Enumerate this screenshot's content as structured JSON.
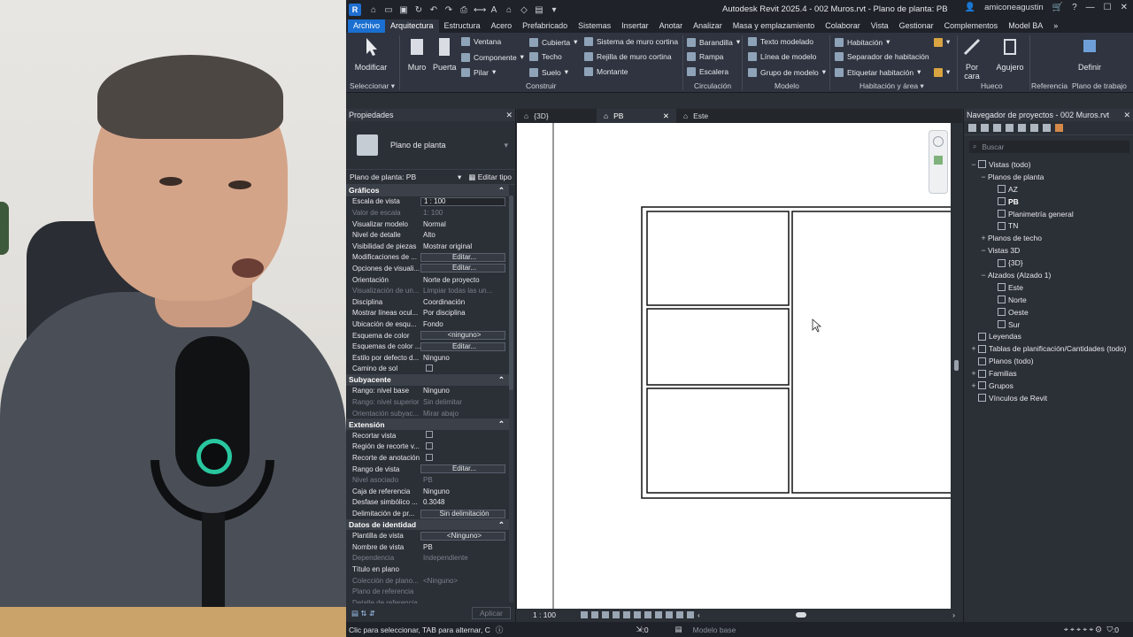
{
  "titlebar": {
    "app_icon_letter": "R",
    "title": "Autodesk Revit 2025.4 - 002 Muros.rvt - Plano de planta: PB",
    "user": "amiconeagustin"
  },
  "ribbon_tabs": [
    "Arquitectura",
    "Estructura",
    "Acero",
    "Prefabricado",
    "Sistemas",
    "Insertar",
    "Anotar",
    "Analizar",
    "Masa y emplazamiento",
    "Colaborar",
    "Vista",
    "Gestionar",
    "Complementos",
    "Model BA"
  ],
  "ribbon_file_tab": "Archivo",
  "ribbon": {
    "modificar": "Modificar",
    "seleccionar": "Seleccionar",
    "muro": "Muro",
    "puerta": "Puerta",
    "ventana": "Ventana",
    "componente": "Componente",
    "pilar": "Pilar",
    "cubierta": "Cubierta",
    "techo": "Techo",
    "suelo": "Suelo",
    "sistema_muro_cortina": "Sistema de muro cortina",
    "rejilla_muro_cortina": "Rejilla de muro cortina",
    "montante": "Montante",
    "construir": "Construir",
    "barandilla": "Barandilla",
    "rampa": "Rampa",
    "escalera": "Escalera",
    "circulacion": "Circulación",
    "texto_modelado": "Texto modelado",
    "linea_modelo": "Línea de modelo",
    "grupo_modelo": "Grupo de modelo",
    "modelo": "Modelo",
    "habitacion": "Habitación",
    "separador_habitacion": "Separador de habitación",
    "etiquetar_habitacion": "Etiquetar habitación",
    "habitacion_area": "Habitación y área",
    "por_cara": "Por cara",
    "agujero": "Agujero",
    "hueco": "Hueco",
    "referencia": "Referencia",
    "definir": "Definir",
    "plano_trabajo": "Plano de trabajo"
  },
  "properties": {
    "title": "Propiedades",
    "type_name": "Plano de planta",
    "instance_selector": "Plano de planta: PB",
    "edit_type": "Editar tipo",
    "sections": [
      {
        "name": "Gráficos",
        "rows": [
          {
            "n": "Escala de vista",
            "v": "1 : 100",
            "kind": "box"
          },
          {
            "n": "Valor de escala",
            "v": "100",
            "pre": "1:",
            "dim": true
          },
          {
            "n": "Visualizar modelo",
            "v": "Normal"
          },
          {
            "n": "Nivel de detalle",
            "v": "Alto"
          },
          {
            "n": "Visibilidad de piezas",
            "v": "Mostrar original"
          },
          {
            "n": "Modificaciones de ...",
            "v": "Editar...",
            "kind": "btn"
          },
          {
            "n": "Opciones de visuali...",
            "v": "Editar...",
            "kind": "btn"
          },
          {
            "n": "Orientación",
            "v": "Norte de proyecto"
          },
          {
            "n": "Visualización de un...",
            "v": "Limpiar todas las un...",
            "dim": true
          },
          {
            "n": "Disciplina",
            "v": "Coordinación"
          },
          {
            "n": "Mostrar líneas ocul...",
            "v": "Por disciplina"
          },
          {
            "n": "Ubicación de esqu...",
            "v": "Fondo"
          },
          {
            "n": "Esquema de color",
            "v": "<ninguno>",
            "kind": "btn"
          },
          {
            "n": "Esquemas de color ...",
            "v": "Editar...",
            "kind": "btn"
          },
          {
            "n": "Estilo por defecto d...",
            "v": "Ninguno"
          },
          {
            "n": "Camino de sol",
            "v": "",
            "kind": "chk"
          }
        ]
      },
      {
        "name": "Subyacente",
        "rows": [
          {
            "n": "Rango: nivel base",
            "v": "Ninguno"
          },
          {
            "n": "Rango: nivel superior",
            "v": "Sin delimitar",
            "dim": true
          },
          {
            "n": "Orientación subyac...",
            "v": "Mirar abajo",
            "dim": true
          }
        ]
      },
      {
        "name": "Extensión",
        "rows": [
          {
            "n": "Recortar vista",
            "v": "",
            "kind": "chk"
          },
          {
            "n": "Región de recorte v...",
            "v": "",
            "kind": "chk"
          },
          {
            "n": "Recorte de anotación",
            "v": "",
            "kind": "chk"
          },
          {
            "n": "Rango de vista",
            "v": "Editar...",
            "kind": "btn"
          },
          {
            "n": "Nivel asociado",
            "v": "PB",
            "dim": true
          },
          {
            "n": "Caja de referencia",
            "v": "Ninguno"
          },
          {
            "n": "Desfase simbólico ...",
            "v": "0.3048"
          },
          {
            "n": "Delimitación de pr...",
            "v": "Sin delimitación",
            "kind": "btn"
          }
        ]
      },
      {
        "name": "Datos de identidad",
        "rows": [
          {
            "n": "Plantilla de vista",
            "v": "<Ninguno>",
            "kind": "btn"
          },
          {
            "n": "Nombre de vista",
            "v": "PB"
          },
          {
            "n": "Dependencia",
            "v": "Independiente",
            "dim": true
          },
          {
            "n": "Título en plano",
            "v": ""
          },
          {
            "n": "Colección de plano...",
            "v": "<Ninguno>",
            "dim": true
          },
          {
            "n": "Plano de referencia",
            "v": "",
            "dim": true
          },
          {
            "n": "Detalle de referencia",
            "v": "",
            "dim": true
          }
        ]
      }
    ],
    "apply": "Aplicar"
  },
  "view_tabs": [
    {
      "label": "{3D}",
      "active": false,
      "closable": false
    },
    {
      "label": "PB",
      "active": true,
      "closable": true
    },
    {
      "label": "Este",
      "active": false,
      "closable": false
    }
  ],
  "view_status": {
    "scale": "1 : 100"
  },
  "browser": {
    "title": "Navegador de proyectos - 002 Muros.rvt",
    "search_placeholder": "Buscar",
    "tree": [
      {
        "label": "Vistas (todo)",
        "indent": 0,
        "toggle": "−",
        "icon": true
      },
      {
        "label": "Planos de planta",
        "indent": 1,
        "toggle": "−",
        "icon": false
      },
      {
        "label": "AZ",
        "indent": 2,
        "toggle": "",
        "icon": true
      },
      {
        "label": "PB",
        "indent": 2,
        "toggle": "",
        "icon": true,
        "bold": true
      },
      {
        "label": "Planimetría general",
        "indent": 2,
        "toggle": "",
        "icon": true
      },
      {
        "label": "TN",
        "indent": 2,
        "toggle": "",
        "icon": true
      },
      {
        "label": "Planos de techo",
        "indent": 1,
        "toggle": "+",
        "icon": false
      },
      {
        "label": "Vistas 3D",
        "indent": 1,
        "toggle": "−",
        "icon": false
      },
      {
        "label": "{3D}",
        "indent": 2,
        "toggle": "",
        "icon": true
      },
      {
        "label": "Alzados (Alzado 1)",
        "indent": 1,
        "toggle": "−",
        "icon": false
      },
      {
        "label": "Este",
        "indent": 2,
        "toggle": "",
        "icon": true
      },
      {
        "label": "Norte",
        "indent": 2,
        "toggle": "",
        "icon": true
      },
      {
        "label": "Oeste",
        "indent": 2,
        "toggle": "",
        "icon": true
      },
      {
        "label": "Sur",
        "indent": 2,
        "toggle": "",
        "icon": true
      },
      {
        "label": "Leyendas",
        "indent": 0,
        "toggle": "",
        "icon": true
      },
      {
        "label": "Tablas de planificación/Cantidades (todo)",
        "indent": 0,
        "toggle": "+",
        "icon": true
      },
      {
        "label": "Planos (todo)",
        "indent": 0,
        "toggle": "",
        "icon": true
      },
      {
        "label": "Familias",
        "indent": 0,
        "toggle": "+",
        "icon": true
      },
      {
        "label": "Grupos",
        "indent": 0,
        "toggle": "+",
        "icon": true
      },
      {
        "label": "Vínculos de Revit",
        "indent": 0,
        "toggle": "",
        "icon": true
      }
    ]
  },
  "statusbar": {
    "hint": "Clic para seleccionar, TAB para alternar, C",
    "zero_a": ":0",
    "model": "Modelo base",
    "zero_b": ":0"
  },
  "colors": {
    "accent": "#1a6fd0",
    "webcam_ring": "#29c7a0"
  }
}
